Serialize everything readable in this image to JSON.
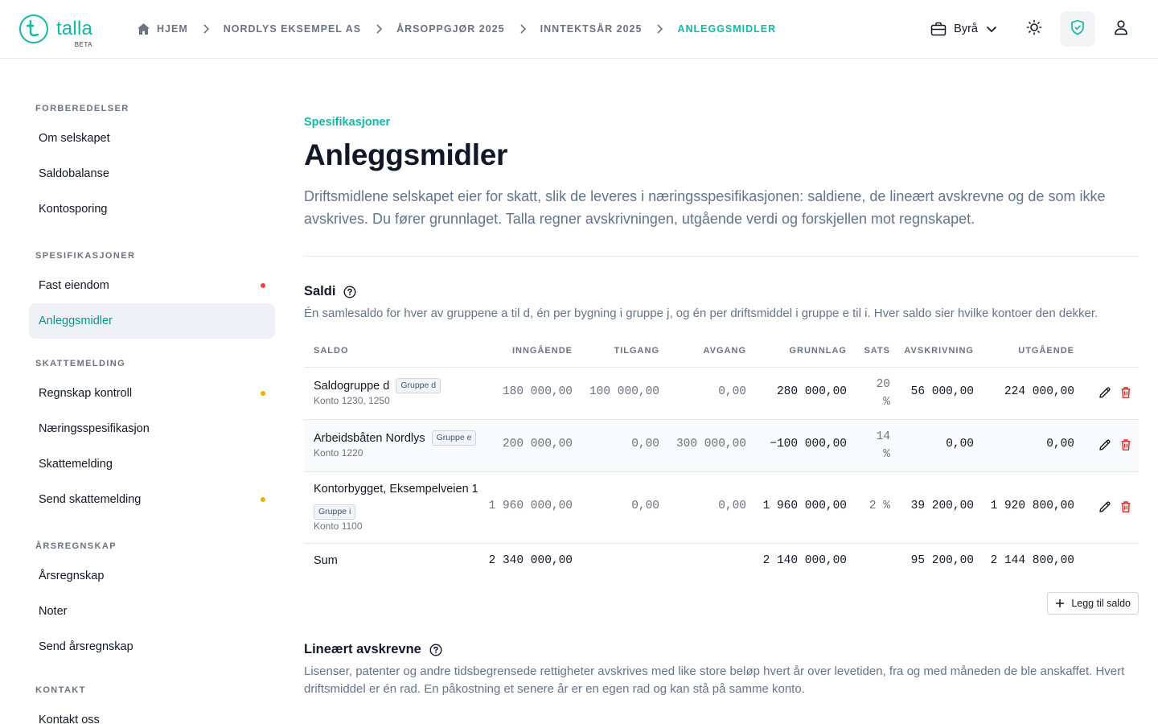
{
  "header": {
    "logo_word": "talla",
    "logo_beta": "BETA",
    "breadcrumbs": [
      "HJEM",
      "NORDLYS EKSEMPEL AS",
      "ÅRSOPPGJØR 2025",
      "INNTEKTSÅR 2025",
      "ANLEGGSMIDLER"
    ],
    "org_switch": "Byrå",
    "icons": [
      "home-icon",
      "briefcase-icon",
      "chevron-down-icon",
      "sun-icon",
      "shield-check-icon",
      "user-icon"
    ],
    "accent_color": "#14b8a6"
  },
  "sidebar": {
    "sections": [
      {
        "title": "FORBEREDELSER",
        "items": [
          {
            "label": "Om selskapet"
          },
          {
            "label": "Saldobalanse"
          },
          {
            "label": "Kontosporing"
          }
        ]
      },
      {
        "title": "SPESIFIKASJONER",
        "items": [
          {
            "label": "Fast eiendom",
            "status": "red"
          },
          {
            "label": "Anleggsmidler",
            "active": true
          }
        ]
      },
      {
        "title": "SKATTEMELDING",
        "items": [
          {
            "label": "Regnskap kontroll",
            "status": "amber"
          },
          {
            "label": "Næringsspesifikasjon"
          },
          {
            "label": "Skattemelding"
          },
          {
            "label": "Send skattemelding",
            "status": "amber"
          }
        ]
      },
      {
        "title": "ÅRSREGNSKAP",
        "items": [
          {
            "label": "Årsregnskap"
          },
          {
            "label": "Noter"
          },
          {
            "label": "Send årsregnskap"
          }
        ]
      },
      {
        "title": "KONTAKT",
        "items": [
          {
            "label": "Kontakt oss"
          }
        ]
      }
    ],
    "status_colors": {
      "red": "#ef4444",
      "amber": "#eab308"
    }
  },
  "main": {
    "eyebrow": "Spesifikasjoner",
    "title": "Anleggsmidler",
    "lead": "Driftsmidlene selskapet eier for skatt, slik de leveres i næringsspesifikasjonen: saldiene, de lineært avskrevne og de som ikke avskrives. Du fører grunnlaget. Talla regner avskrivningen, utgående verdi og forskjellen mot regnskapet.",
    "saldi": {
      "heading": "Saldi",
      "description": "Én samlesaldo for hver av gruppene a til d, én per bygning i gruppe j, og én per driftsmiddel i gruppe e til i. Hver saldo sier hvilke kontoer den dekker.",
      "columns": [
        "SALDO",
        "INNGÅENDE",
        "TILGANG",
        "AVGANG",
        "GRUNNLAG",
        "SATS",
        "AVSKRIVNING",
        "UTGÅENDE"
      ],
      "rows": [
        {
          "name": "Saldogruppe d",
          "group": "Gruppe d",
          "accounts": "Konto 1230, 1250",
          "inngaende": "180 000,00",
          "tilgang": "100 000,00",
          "avgang": "0,00",
          "grunnlag": "280 000,00",
          "sats_1": "20",
          "sats_2": "%",
          "avskrivning": "56 000,00",
          "utgaende": "224 000,00"
        },
        {
          "name": "Arbeidsbåten Nordlys",
          "group": "Gruppe e",
          "accounts": "Konto 1220",
          "inngaende": "200 000,00",
          "tilgang": "0,00",
          "avgang": "300 000,00",
          "grunnlag": "−100 000,00",
          "sats_1": "14",
          "sats_2": "%",
          "avskrivning": "0,00",
          "utgaende": "0,00"
        },
        {
          "name": "Kontorbygget, Eksempelveien 1",
          "group": "Gruppe i",
          "accounts": "Konto 1100",
          "inngaende": "1 960 000,00",
          "tilgang": "0,00",
          "avgang": "0,00",
          "grunnlag": "1 960 000,00",
          "sats": "2 %",
          "avskrivning": "39 200,00",
          "utgaende": "1 920 800,00"
        }
      ],
      "sum": {
        "label": "Sum",
        "inngaende": "2 340 000,00",
        "grunnlag": "2 140 000,00",
        "avskrivning": "95 200,00",
        "utgaende": "2 144 800,00"
      },
      "add_label": "Legg til saldo"
    },
    "linear": {
      "heading": "Lineært avskrevne",
      "description": "Lisenser, patenter og andre tidsbegrensede rettigheter avskrives med like store beløp hvert år over levetiden, fra og med måneden de ble anskaffet. Hvert driftsmiddel er én rad. En påkostning et senere år er en egen rad og kan stå på samme konto."
    }
  }
}
